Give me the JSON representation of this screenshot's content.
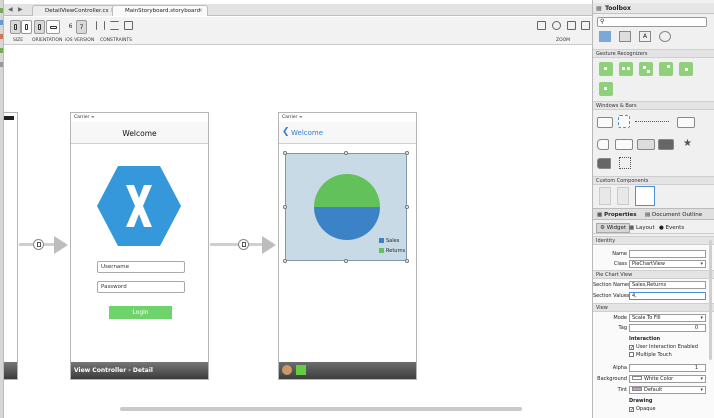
{
  "tabs": [
    {
      "label": "DetailViewController.cs",
      "active": false
    },
    {
      "label": "MainStoryboard.storyboard",
      "active": true
    }
  ],
  "toolbar": {
    "size_label": "SIZE",
    "orientation_label": "ORIENTATION",
    "ios_version_label": "iOS VERSION",
    "ios_version_values": [
      "6",
      "7"
    ],
    "constraints_label": "CONSTRAINTS",
    "zoom_label": "ZOOM"
  },
  "scene_detail": {
    "carrier": "Carrier",
    "title": "Welcome",
    "username_placeholder": "Username",
    "password_placeholder": "Password",
    "login_label": "Login",
    "footer": "View Controller - Detail"
  },
  "scene_chart": {
    "carrier": "Carrier",
    "back_label": "Welcome",
    "legend": [
      {
        "name": "Sales",
        "color": "#3b83c6"
      },
      {
        "name": "Returns",
        "color": "#62c15b"
      }
    ],
    "chart_data": {
      "type": "pie",
      "categories": [
        "Sales",
        "Returns"
      ],
      "values": [
        50,
        50
      ]
    }
  },
  "toolbox": {
    "title": "Toolbox",
    "search_placeholder": "",
    "sections": {
      "gesture": "Gesture Recognizers",
      "windows": "Windows & Bars",
      "custom": "Custom Components"
    }
  },
  "properties": {
    "tab_properties": "Properties",
    "tab_outline": "Document Outline",
    "subtabs": [
      "Widget",
      "Layout",
      "Events"
    ],
    "identity_header": "Identity",
    "name_label": "Name",
    "name_value": "",
    "class_label": "Class",
    "class_value": "PieChartView",
    "pie_header": "Pie Chart View",
    "section_names_label": "Section Names",
    "section_names_value": "Sales,Returns",
    "section_values_label": "Section Values",
    "section_values_value": "4,",
    "view_header": "View",
    "mode_label": "Mode",
    "mode_value": "Scale To Fill",
    "tag_label": "Tag",
    "tag_value": "0",
    "interaction_header": "Interaction",
    "user_interaction": "User Interaction Enabled",
    "multiple_touch": "Multiple Touch",
    "alpha_label": "Alpha",
    "alpha_value": "1",
    "background_label": "Background",
    "background_value": "White Color",
    "tint_label": "Tint",
    "tint_value": "Default",
    "drawing_header": "Drawing",
    "opaque_label": "Opaque"
  },
  "colors": {
    "xamarin_blue": "#3498db",
    "login_green": "#6fd36b",
    "chart_bg": "#c8dae6"
  }
}
